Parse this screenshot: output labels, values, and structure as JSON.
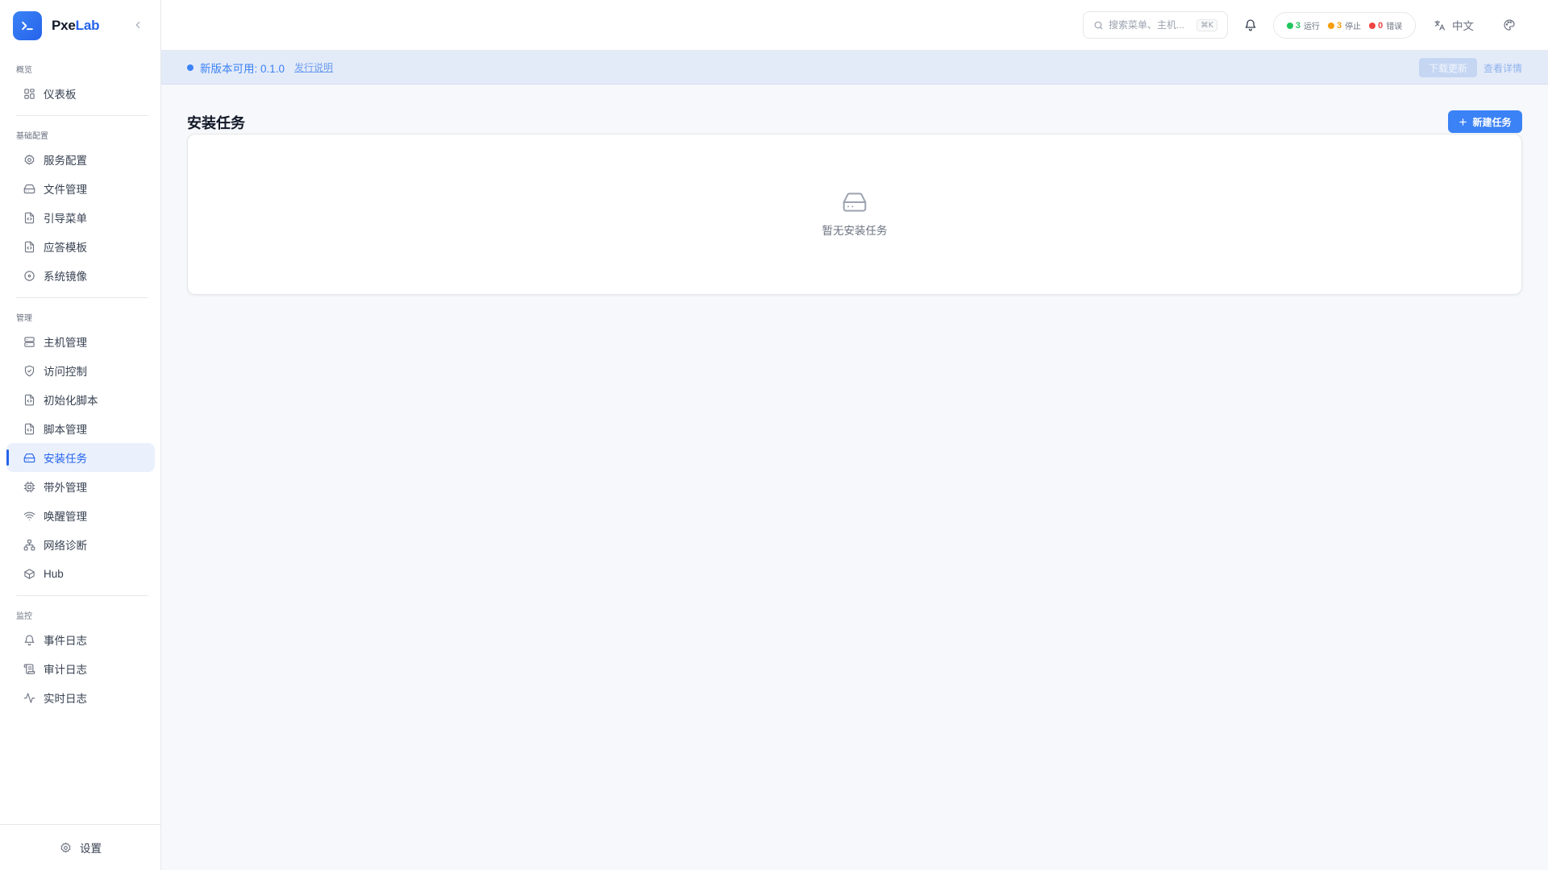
{
  "brand": {
    "name_prefix": "Pxe",
    "name_accent": "Lab"
  },
  "sidebar": {
    "sections": [
      {
        "title": "概览",
        "items": [
          {
            "label": "仪表板",
            "icon": "dashboard-icon"
          }
        ]
      },
      {
        "title": "基础配置",
        "items": [
          {
            "label": "服务配置",
            "icon": "gear-icon"
          },
          {
            "label": "文件管理",
            "icon": "hard-drive-icon"
          },
          {
            "label": "引导菜单",
            "icon": "code-file-icon"
          },
          {
            "label": "应答模板",
            "icon": "code-file-icon"
          },
          {
            "label": "系统镜像",
            "icon": "disc-icon"
          }
        ]
      },
      {
        "title": "管理",
        "items": [
          {
            "label": "主机管理",
            "icon": "server-icon"
          },
          {
            "label": "访问控制",
            "icon": "shield-icon"
          },
          {
            "label": "初始化脚本",
            "icon": "code-file-icon"
          },
          {
            "label": "脚本管理",
            "icon": "code-file-icon"
          },
          {
            "label": "安装任务",
            "icon": "hard-drive-icon",
            "active": true
          },
          {
            "label": "带外管理",
            "icon": "cpu-icon"
          },
          {
            "label": "唤醒管理",
            "icon": "wifi-icon"
          },
          {
            "label": "网络诊断",
            "icon": "network-icon"
          },
          {
            "label": "Hub",
            "icon": "package-icon"
          }
        ]
      },
      {
        "title": "监控",
        "items": [
          {
            "label": "事件日志",
            "icon": "bell-icon"
          },
          {
            "label": "审计日志",
            "icon": "scroll-icon"
          },
          {
            "label": "实时日志",
            "icon": "activity-icon"
          }
        ]
      }
    ],
    "footer": {
      "label": "设置",
      "icon": "gear-icon"
    }
  },
  "topbar": {
    "search": {
      "placeholder": "搜索菜单、主机...",
      "value": "",
      "shortcut": "⌘K"
    },
    "status": {
      "running": {
        "count": "3",
        "label": "运行",
        "color": "#22c55e"
      },
      "stopped": {
        "count": "3",
        "label": "停止",
        "color": "#f59e0b"
      },
      "error": {
        "count": "0",
        "label": "错误",
        "color": "#ef4444"
      }
    },
    "language": "中文"
  },
  "banner": {
    "text": "新版本可用: 0.1.0",
    "link": "发行说明",
    "download": "下载更新",
    "details": "查看详情"
  },
  "page": {
    "title": "安装任务",
    "new_button": "新建任务",
    "empty_text": "暂无安装任务"
  },
  "colors": {
    "accent": "#2563eb",
    "button": "#3b82f6"
  }
}
